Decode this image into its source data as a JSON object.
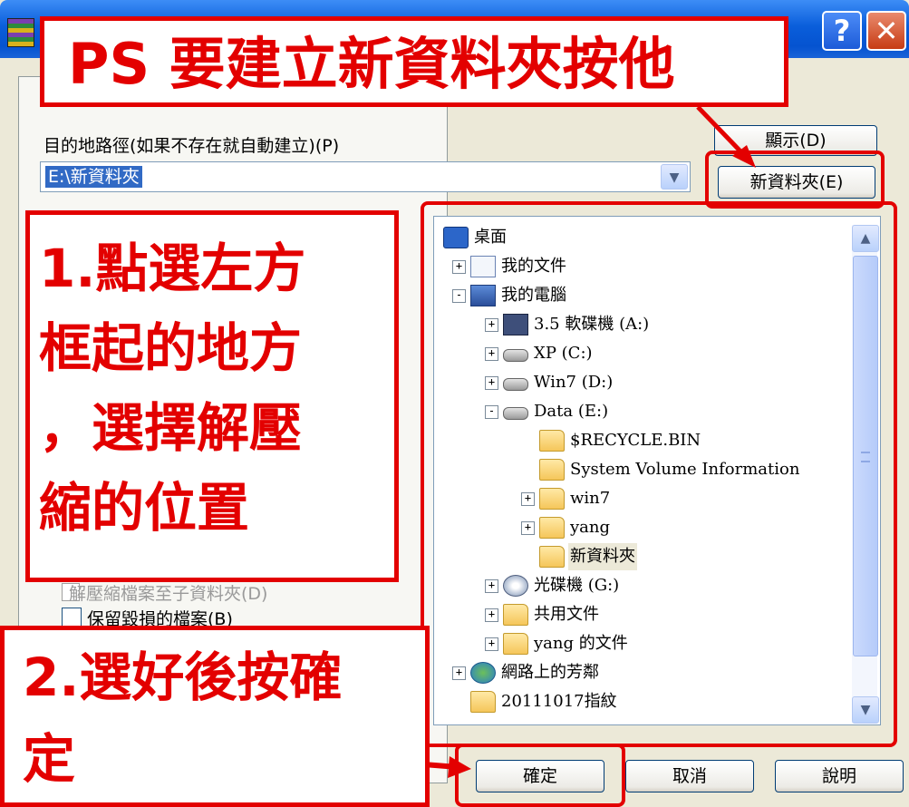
{
  "window": {
    "help_glyph": "?",
    "close_glyph": "✕"
  },
  "dialog": {
    "dest_label": "目的地路徑(如果不存在就自動建立)(P)",
    "path_value": "E:\\新資料夾",
    "show_button": "顯示(D)",
    "newfolder_button": "新資料夾(E)",
    "opt_extract": "解壓縮檔案至子資料夾(D)",
    "opt_keep": "保留毀損的檔案(B)",
    "ok_button": "確定",
    "cancel_button": "取消",
    "help_button": "說明"
  },
  "tree": {
    "nodes": [
      {
        "label": "桌面",
        "icon": "desktop-icon"
      },
      {
        "label": "我的文件",
        "icon": "my-documents-icon"
      },
      {
        "label": "我的電腦",
        "icon": "my-computer-icon"
      },
      {
        "label": "3.5 軟碟機 (A:)",
        "icon": "floppy-drive-icon"
      },
      {
        "label": "XP (C:)",
        "icon": "hard-drive-icon"
      },
      {
        "label": "Win7 (D:)",
        "icon": "hard-drive-icon"
      },
      {
        "label": "Data (E:)",
        "icon": "hard-drive-icon"
      },
      {
        "label": "$RECYCLE.BIN",
        "icon": "folder-icon"
      },
      {
        "label": "System Volume Information",
        "icon": "folder-icon"
      },
      {
        "label": "win7",
        "icon": "folder-icon"
      },
      {
        "label": "yang",
        "icon": "folder-icon"
      },
      {
        "label": "新資料夾",
        "icon": "folder-icon",
        "selected": true
      },
      {
        "label": "光碟機 (G:)",
        "icon": "cd-drive-icon"
      },
      {
        "label": "共用文件",
        "icon": "folder-icon"
      },
      {
        "label": "yang 的文件",
        "icon": "folder-icon"
      },
      {
        "label": "網路上的芳鄰",
        "icon": "network-icon"
      },
      {
        "label": "20111017指紋",
        "icon": "folder-icon"
      }
    ]
  },
  "annotations": {
    "top": "PS 要建立新資料夾按他",
    "step1": [
      "1.點選左方",
      "框起的地方",
      "，選擇解壓",
      "縮的位置"
    ],
    "step2": [
      "2.選好後按確",
      "定"
    ]
  },
  "colors": {
    "annotation_red": "#E30000",
    "titlebar_blue": "#0A5EDB",
    "selection_blue": "#316AC5",
    "dialog_bg": "#ECE9D8"
  }
}
